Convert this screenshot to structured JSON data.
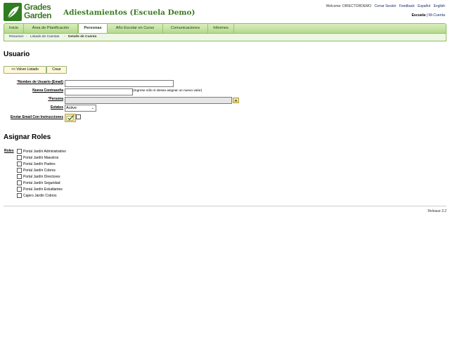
{
  "brand": {
    "logo_line1": "Grades",
    "logo_line2": "Garden"
  },
  "school_title": "Adiestamientos (Escuela Demo)",
  "top_links": {
    "welcome": "Welcome: DIRECTORDEMO",
    "logout": "Cerrar Sesión",
    "feedback": "Feedback",
    "lang_es": "Español",
    "lang_en": "English"
  },
  "sub_links": {
    "school": "Escuela",
    "account": "Mi Cuenta"
  },
  "nav": [
    "Inicio",
    "Área de Planificación",
    "Personas",
    "Año Escolar en Curso",
    "Comunicaciones",
    "Informes"
  ],
  "breadcrumb": [
    "Resumen",
    "Listado de Cuentas",
    "Detalle de Cuenta"
  ],
  "page_title": "Usuario",
  "buttons": {
    "back": "<< Volver Listado",
    "create": "Crear"
  },
  "form": {
    "username_label": "Nombre de Usuario (Email)",
    "password_label": "Nueva Contraseña",
    "password_hint": "(Ingrese sólo si desea asignar un nuevo valor)",
    "person_label": "Persona",
    "status_label": "Estatus",
    "status_value": "Active",
    "email_label": "Enviar Email Con Instrucciones",
    "required_mark": "*"
  },
  "roles_title": "Asignar Roles",
  "roles_label": "Roles",
  "roles": [
    "Portal Jardín Administrativo",
    "Portal Jardín Maestros",
    "Portal Jardín Padres",
    "Portal Jardín Cobros",
    "Portal Jardín Directores",
    "Portal Jardín Seguridad",
    "Portal Jardín Estudiantes",
    "Cajero Jardín Cobros"
  ],
  "release": "Release 3.2",
  "colors": {
    "brand_green": "#3c7a22",
    "nav_bg": "#c5e3a3",
    "required": "#c00000"
  }
}
